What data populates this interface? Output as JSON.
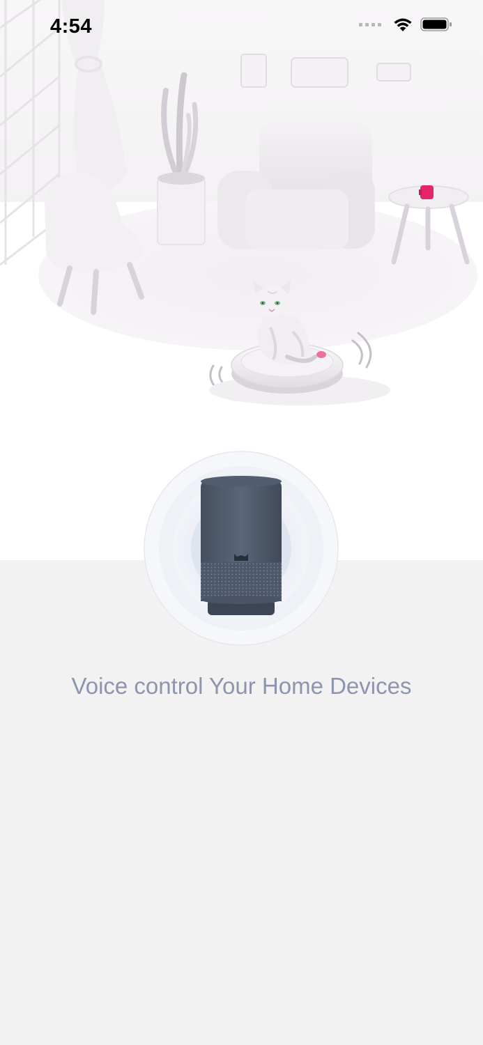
{
  "status_bar": {
    "time": "4:54",
    "signal_icon": "cellular-signal-icon",
    "wifi_icon": "wifi-icon",
    "battery_icon": "battery-icon"
  },
  "hero": {
    "illustration": "living-room-illustration",
    "cat_icon": "cat-icon",
    "robot_vacuum_icon": "robot-vacuum-icon",
    "speaker_icon": "smart-speaker-icon"
  },
  "tagline": "Voice control Your Home Devices",
  "colors": {
    "background": "#f2f2f2",
    "top_background": "#ffffff",
    "tagline": "#8c95ad",
    "speaker_body": "#4e5a6c",
    "accent_pink": "#e5246a"
  }
}
